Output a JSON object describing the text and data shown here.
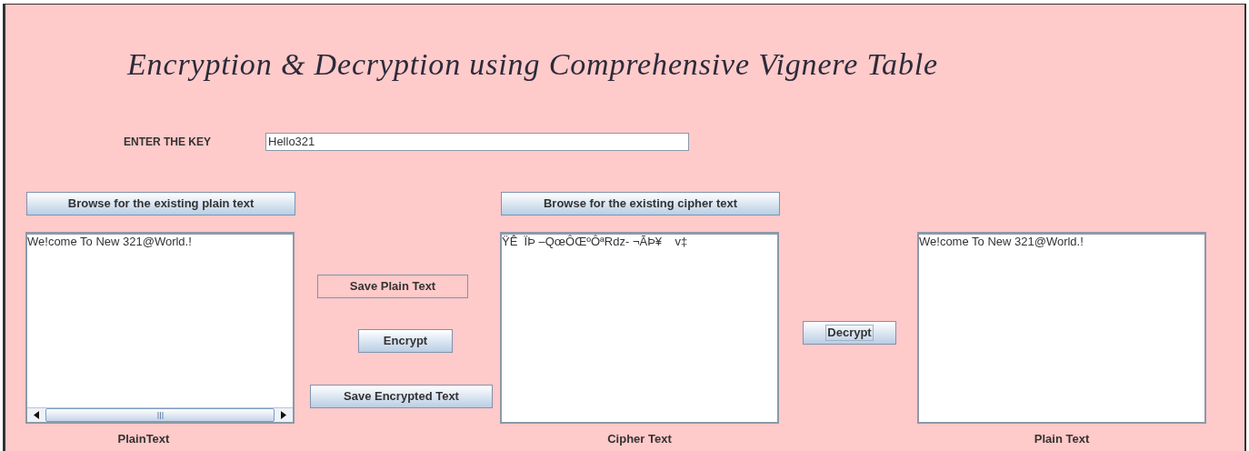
{
  "title": "Encryption & Decryption using Comprehensive Vignere Table",
  "key": {
    "label": "ENTER THE KEY",
    "value": "Hello321"
  },
  "browse_buttons": [
    "Browse for the existing plain text",
    "Browse for the existing cipher text"
  ],
  "panels": [
    {
      "text": "We!come To New 321@World.!",
      "caption": "PlainText",
      "scrollbar": true
    },
    {
      "text": "ŸÊ  ÏÞ ‒QœÔŒºÔªRdz- ¬ÃÞ¥    v‡",
      "caption": "Cipher Text",
      "scrollbar": false
    },
    {
      "text": "We!come To New 321@World.!",
      "caption": "Plain Text",
      "scrollbar": false
    }
  ],
  "action_buttons": [
    {
      "label": "Save Plain Text",
      "kind": "flat"
    },
    {
      "label": "Encrypt",
      "kind": "raised"
    },
    {
      "label": "Save Encrypted Text",
      "kind": "raised"
    }
  ],
  "decrypt_button": {
    "label": "Decrypt",
    "focused": true
  }
}
